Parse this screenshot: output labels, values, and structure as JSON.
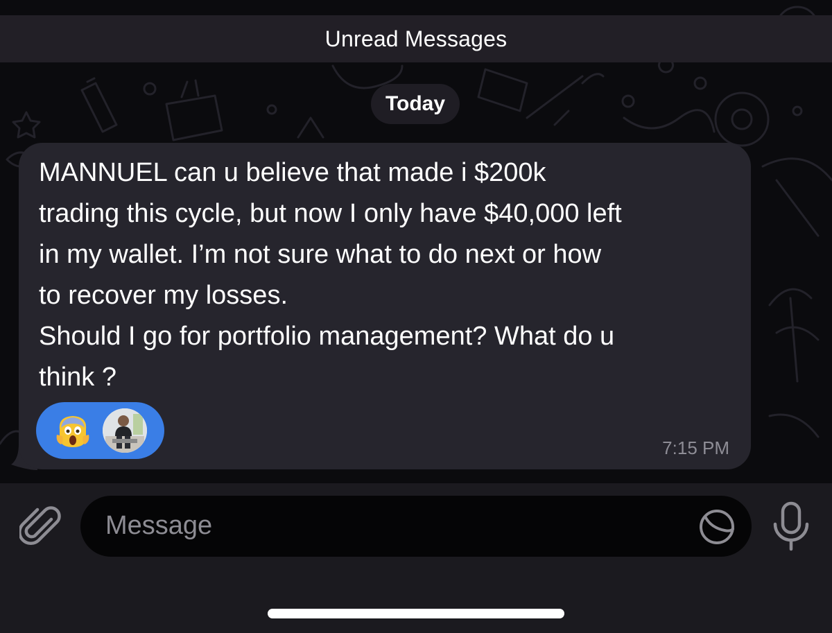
{
  "header": {
    "unread_label": "Unread Messages"
  },
  "chat": {
    "date_label": "Today",
    "message": {
      "text": "MANNUEL can u believe that made i $200k\ntrading this cycle, but now I only have $40,000 left\nin my wallet. I’m not sure what to do next or how\nto recover my losses.\nShould I go for portfolio management? What do u\nthink ?",
      "time": "7:15 PM",
      "reaction": {
        "emoji_name": "face-screaming-in-fear",
        "reactor": "avatar"
      }
    }
  },
  "composer": {
    "placeholder": "Message",
    "icons": [
      "paperclip-icon",
      "sticker-icon",
      "microphone-icon"
    ]
  },
  "colors": {
    "chat_background": "#0b0b0e",
    "bubble": "#26252d",
    "reaction_pill": "#3a7ee6",
    "timestamp": "#8e8d96",
    "input_bar": "#1b1a1f"
  }
}
